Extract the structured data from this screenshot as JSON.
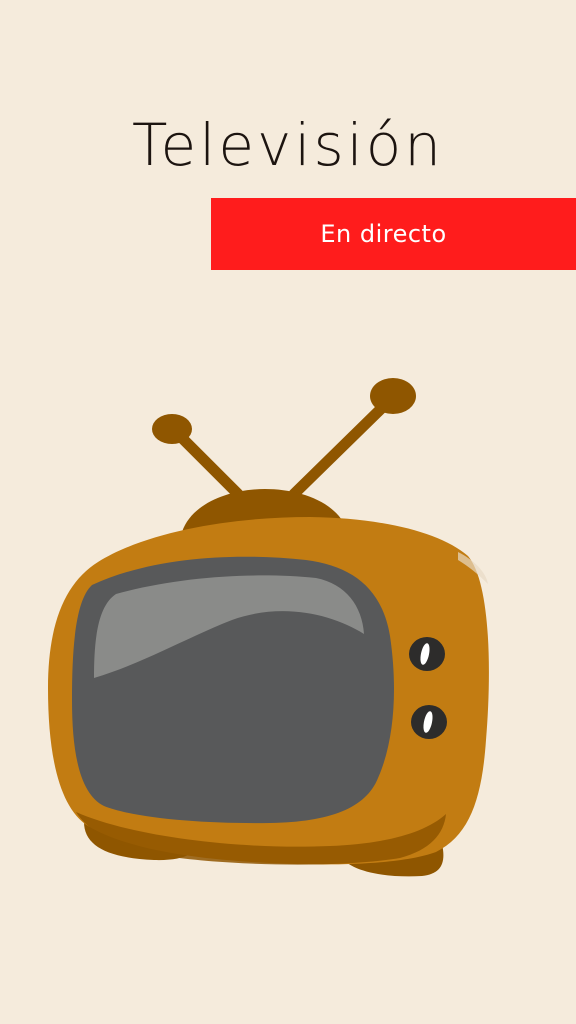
{
  "header": {
    "title": "Televisión"
  },
  "banner": {
    "label": "En directo",
    "color": "#FF1C1C"
  },
  "illustration": {
    "icon": "retro-television-icon",
    "colors": {
      "background": "#F5EBDC",
      "body": "#C27C12",
      "accent": "#8F5600",
      "screen": "#58595A",
      "screen_glare": "#8A8B89"
    }
  }
}
